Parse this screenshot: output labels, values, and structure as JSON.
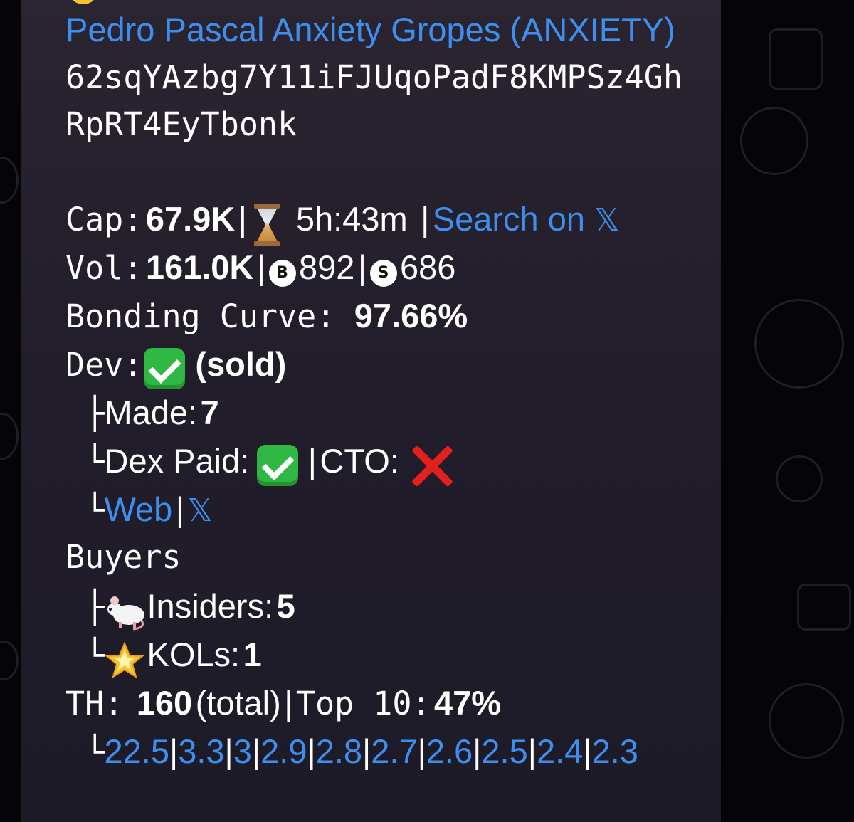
{
  "token": {
    "name": "Pedro Pascal Anxiety Gropes (ANXIETY)",
    "address_line1": "62sqYAzbg7Y11iFJUqoPadF8KMPSz4Gh",
    "address_line2": "RpRT4EyTbonk"
  },
  "stats": {
    "cap_label": "Cap:",
    "cap_value": "67.9K",
    "age": "5h:43m",
    "search_label": "Search on",
    "vol_label": "Vol:",
    "vol_value": "161.0K",
    "buys_badge": "B",
    "buys": "892",
    "sells_badge": "S",
    "sells": "686",
    "sep": "|",
    "bonding_label": "Bonding Curve:",
    "bonding_value": "97.66%"
  },
  "dev": {
    "label": "Dev:",
    "status": "(sold)",
    "made_label": "Made:",
    "made_value": "7",
    "dex_paid_label": "Dex Paid:",
    "cto_label": "CTO:",
    "web_label": "Web"
  },
  "buyers": {
    "label": "Buyers",
    "insiders_label": "Insiders:",
    "insiders_value": "5",
    "kols_label": "KOLs:",
    "kols_value": "1"
  },
  "holders": {
    "th_label": "TH:",
    "th_value": "160",
    "total_label": "(total)",
    "top10_label": "Top 10:",
    "top10_value": "47%",
    "top_percents": [
      "22.5",
      "3.3",
      "3",
      "2.9",
      "2.8",
      "2.7",
      "2.6",
      "2.5",
      "2.4",
      "2.3"
    ]
  },
  "icons": {
    "hourglass": "hourglass-icon",
    "x_logo": "x-logo-icon",
    "check": "check-mark-button-icon",
    "cross": "cross-mark-icon",
    "rat": "rat-icon",
    "star": "glowing-star-icon"
  },
  "colors": {
    "link": "#3e8ef0",
    "check_green": "#2fb844",
    "cross_red": "#e3201b"
  }
}
